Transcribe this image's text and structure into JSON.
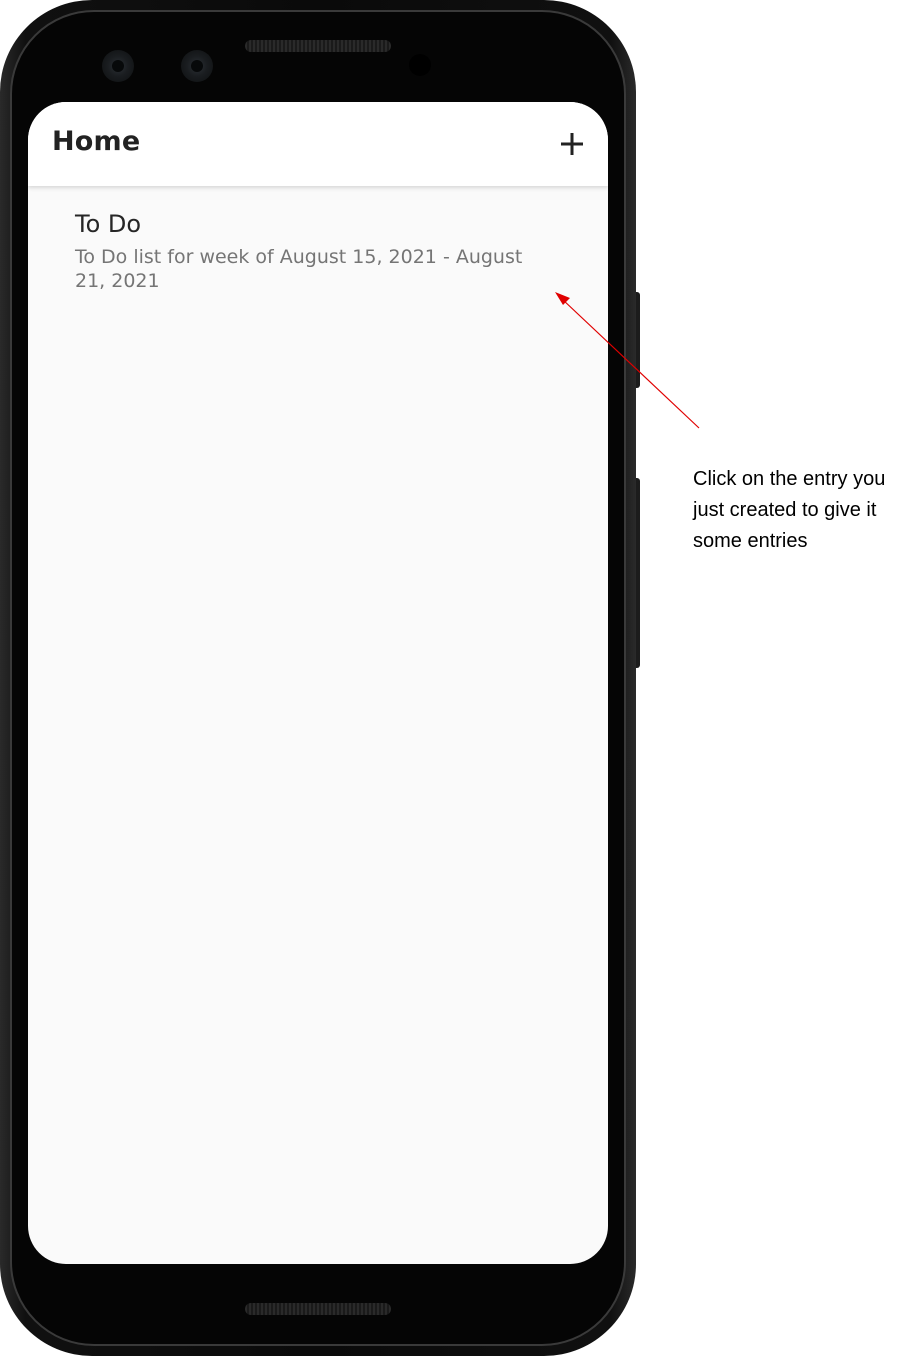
{
  "app_bar": {
    "title": "Home",
    "add_icon": "plus-icon"
  },
  "list": {
    "items": [
      {
        "title": "To Do",
        "subtitle": "To Do list for week of August 15, 2021 - August 21, 2021"
      }
    ]
  },
  "annotation": {
    "text": "Click on the entry you just created to give it some entries",
    "arrow_color": "#e00000"
  },
  "colors": {
    "screen_background": "#fafafa",
    "app_bar_background": "#ffffff",
    "subtitle_text": "#757575"
  }
}
